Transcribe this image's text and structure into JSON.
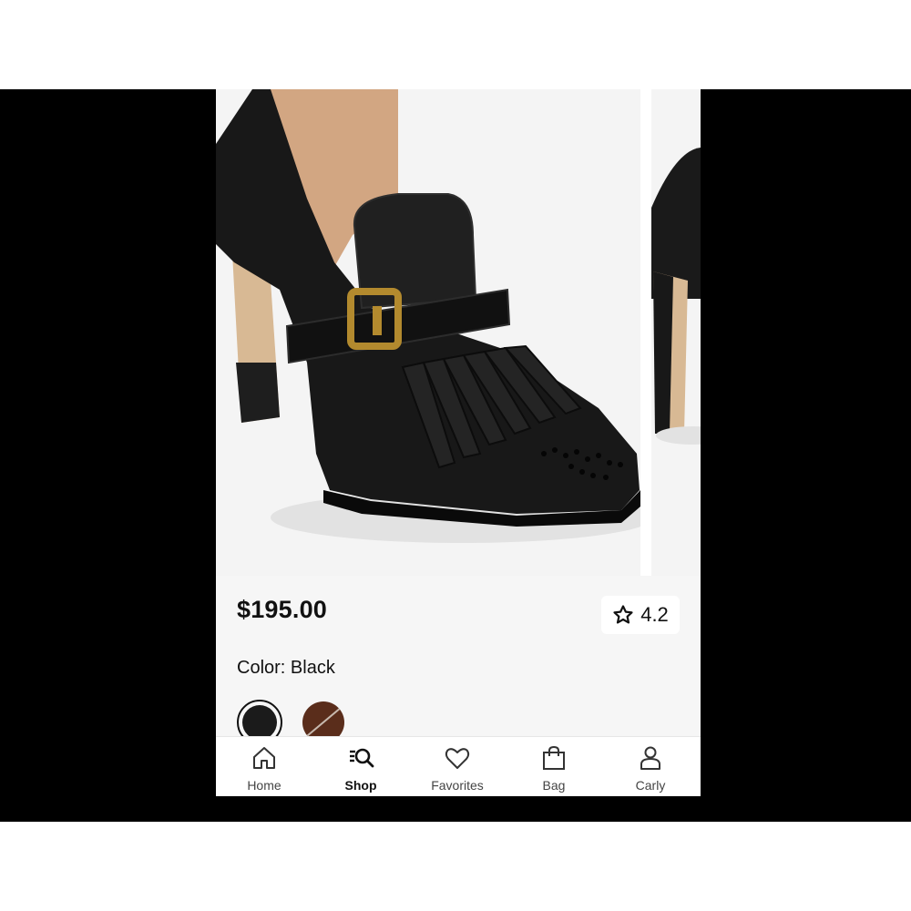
{
  "product": {
    "price": "$195.00",
    "rating": "4.2",
    "color_label": "Color: Black",
    "swatches": [
      {
        "name": "Black",
        "color": "#1b1b1b",
        "selected": true
      },
      {
        "name": "Brown",
        "color": "#5a2d1b",
        "selected": false
      }
    ]
  },
  "tabs": [
    {
      "label": "Home",
      "icon": "home-icon"
    },
    {
      "label": "Shop",
      "icon": "search-list-icon",
      "active": true
    },
    {
      "label": "Favorites",
      "icon": "heart-icon"
    },
    {
      "label": "Bag",
      "icon": "bag-icon"
    },
    {
      "label": "Carly",
      "icon": "person-icon"
    }
  ]
}
